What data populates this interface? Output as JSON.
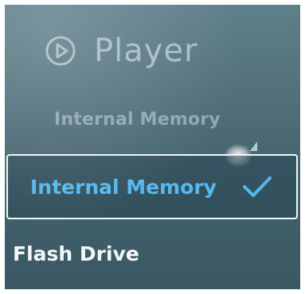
{
  "header": {
    "title": "Player",
    "icon": "play-circle-icon"
  },
  "source_selector": {
    "current_value": "Internal Memory",
    "arrow_icon": "dropdown-arrow-icon"
  },
  "options": [
    {
      "label": "Internal Memory",
      "selected": true,
      "check_icon": "check-icon"
    },
    {
      "label": "Flash Drive",
      "selected": false
    }
  ],
  "colors": {
    "selected_text": "#56b8ef",
    "check": "#56b8ef",
    "background": "#4b6a76"
  }
}
